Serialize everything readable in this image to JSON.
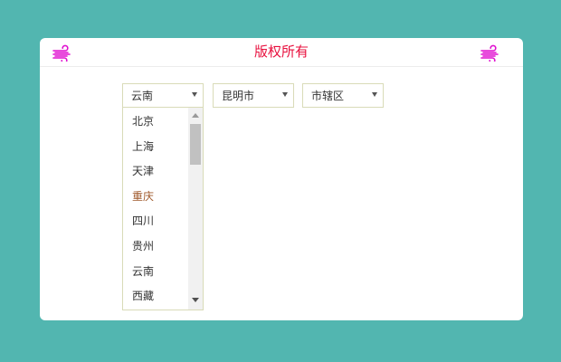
{
  "header": {
    "title": "版权所有",
    "left_icon": "wind-icon",
    "right_icon": "wind-icon",
    "accent_color": "#e8103e",
    "icon_color": "#e010d0"
  },
  "selects": {
    "province": "云南",
    "city": "昆明市",
    "district": "市辖区"
  },
  "province_options": [
    "北京",
    "上海",
    "天津",
    "重庆",
    "四川",
    "贵州",
    "云南",
    "西藏"
  ],
  "colors": {
    "background": "#52b6b0",
    "card": "#ffffff",
    "select_border": "#d9dbb8"
  }
}
